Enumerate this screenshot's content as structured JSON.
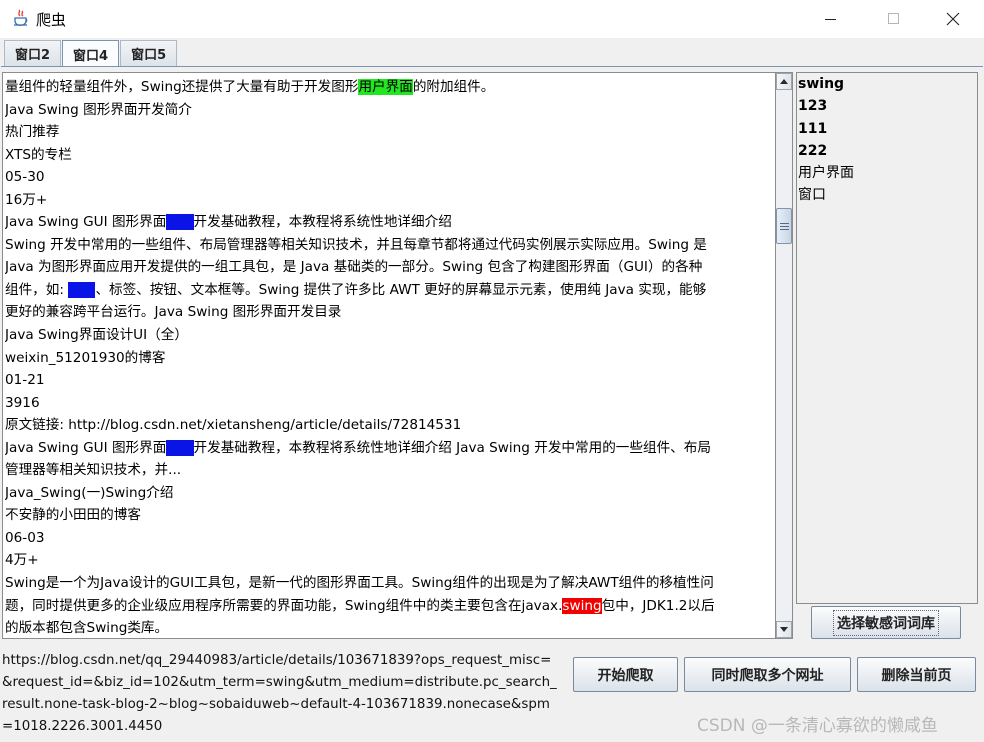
{
  "window": {
    "title": "爬虫",
    "minimize": "minimize",
    "maximize": "maximize",
    "close": "close"
  },
  "tabs": [
    {
      "label": "窗口2",
      "active": false
    },
    {
      "label": "窗口4",
      "active": true
    },
    {
      "label": "窗口5",
      "active": false
    }
  ],
  "content": {
    "l0_a": "量组件的轻量组件外，Swing还提供了大量有助于开发图形",
    "l0_hl": "用户界面",
    "l0_b": "的附加组件。",
    "l1": "Java Swing 图形界面开发简介",
    "l2": "热门推荐",
    "l3": "XTS的专栏",
    "l4": "05-30",
    "l5": "16万+",
    "l6_a": "Java Swing GUI 图形界面",
    "l6_hl": "窗口",
    "l6_b": "开发基础教程，本教程将系统性地详细介绍",
    "l7": "Swing 开发中常用的一些组件、布局管理器等相关知识技术，并且每章节都将通过代码实例展示实际应用。Swing 是",
    "l8": "Java 为图形界面应用开发提供的一组工具包，是 Java 基础类的一部分。Swing 包含了构建图形界面（GUI）的各种",
    "l9_a": "组件，如: ",
    "l9_hl": "窗口",
    "l9_b": "、标签、按钮、文本框等。Swing 提供了许多比 AWT 更好的屏幕显示元素，使用纯 Java 实现，能够",
    "l10": "更好的兼容跨平台运行。Java Swing 图形界面开发目录",
    "l11": "Java Swing界面设计UI（全）",
    "l12": "weixin_51201930的博客",
    "l13": "01-21",
    "l14": "3916",
    "l15": "原文链接: http://blog.csdn.net/xietansheng/article/details/72814531",
    "l16_a": "Java Swing GUI 图形界面",
    "l16_hl": "窗口",
    "l16_b": "开发基础教程，本教程将系统性地详细介绍 Java Swing 开发中常用的一些组件、布局",
    "l17": "管理器等相关知识技术，并...",
    "l18": "Java_Swing(一)Swing介绍",
    "l19": "不安静的小田田的博客",
    "l20": "06-03",
    "l21": "4万+",
    "l22": "Swing是一个为Java设计的GUI工具包，是新一代的图形界面工具。Swing组件的出现是为了解决AWT组件的移植性问",
    "l23_a": "题，同时提供更多的企业级应用程序所需要的界面功能，Swing组件中的类主要包含在javax.",
    "l23_hl": "swing",
    "l23_b": "包中，JDK1.2以后",
    "l24": "的版本都包含Swing类库。"
  },
  "highlight_colors": {
    "green": "#22e622",
    "blue": "#0a14e6",
    "red": "#f00000"
  },
  "keywords": [
    {
      "text": "swing",
      "bold": true
    },
    {
      "text": "123",
      "bold": true
    },
    {
      "text": "111",
      "bold": true
    },
    {
      "text": "222",
      "bold": true
    },
    {
      "text": "用户界面",
      "bold": false
    },
    {
      "text": "窗口",
      "bold": false
    }
  ],
  "buttons": {
    "select_dict": "选择敏感词词库",
    "start": "开始爬取",
    "multi": "同时爬取多个网址",
    "delete": "删除当前页"
  },
  "url": "https://blog.csdn.net/qq_29440983/article/details/103671839?ops_request_misc=&request_id=&biz_id=102&utm_term=swing&utm_medium=distribute.pc_search_result.none-task-blog-2~blog~sobaiduweb~default-4-103671839.nonecase&spm=1018.2226.3001.4450",
  "watermark": "CSDN @一条清心寡欲的懒咸鱼"
}
